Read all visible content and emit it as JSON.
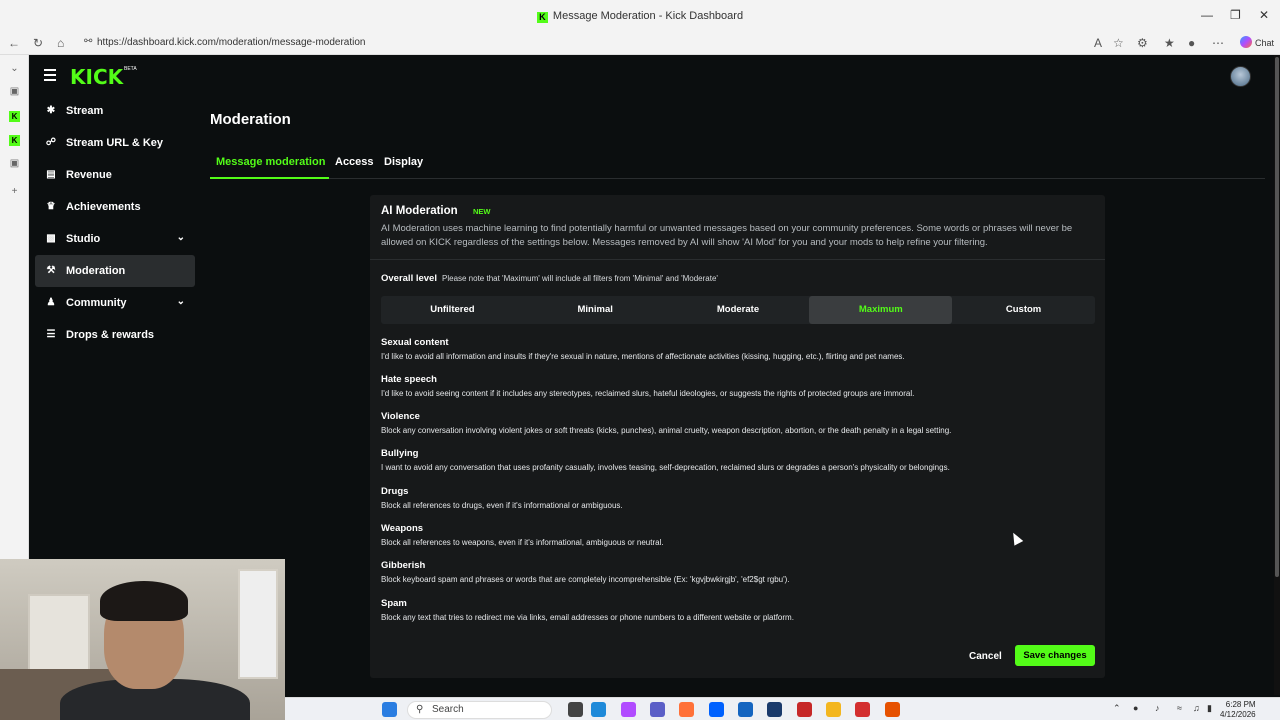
{
  "browser": {
    "window_title": "Message Moderation - Kick Dashboard",
    "url": "https://dashboard.kick.com/moderation/message-moderation",
    "chat_label": "Chat"
  },
  "app": {
    "logo": "KICK",
    "logo_badge": "BETA"
  },
  "sidebar": {
    "items": [
      {
        "label": "Stream",
        "icon": "broadcast-icon"
      },
      {
        "label": "Stream URL & Key",
        "icon": "link-icon"
      },
      {
        "label": "Revenue",
        "icon": "chart-icon"
      },
      {
        "label": "Achievements",
        "icon": "trophy-icon"
      },
      {
        "label": "Studio",
        "icon": "monitor-icon"
      },
      {
        "label": "Moderation",
        "icon": "wrench-icon"
      },
      {
        "label": "Community",
        "icon": "people-icon"
      },
      {
        "label": "Drops & rewards",
        "icon": "gift-icon"
      }
    ]
  },
  "page": {
    "title": "Moderation",
    "tabs": [
      {
        "label": "Message moderation"
      },
      {
        "label": "Access"
      },
      {
        "label": "Display"
      }
    ]
  },
  "ai_moderation": {
    "title": "AI Moderation",
    "badge": "NEW",
    "description": "AI Moderation uses machine learning to find potentially harmful or unwanted messages based on your community preferences. Some words or phrases will never be allowed on KICK regardless of the settings below. Messages removed by AI will show 'AI Mod' for you and your mods to help refine your filtering.",
    "overall_label": "Overall level",
    "overall_note": "Please note that 'Maximum' will include all filters from 'Minimal' and 'Moderate'",
    "levels": [
      "Unfiltered",
      "Minimal",
      "Moderate",
      "Maximum",
      "Custom"
    ],
    "selected_level": "Maximum",
    "categories": [
      {
        "title": "Sexual content",
        "desc": "I'd like to avoid all information and insults if they're sexual in nature, mentions of affectionate activities (kissing, hugging, etc.), flirting and pet names."
      },
      {
        "title": "Hate speech",
        "desc": "I'd like to avoid seeing content if it includes any stereotypes, reclaimed slurs, hateful ideologies, or suggests the rights of protected groups are immoral."
      },
      {
        "title": "Violence",
        "desc": "Block any conversation involving violent jokes or soft threats (kicks, punches), animal cruelty, weapon description, abortion, or the death penalty in a legal setting."
      },
      {
        "title": "Bullying",
        "desc": "I want to avoid any conversation that uses profanity casually, involves teasing, self-deprecation, reclaimed slurs or degrades a person's physicality or belongings."
      },
      {
        "title": "Drugs",
        "desc": "Block all references to drugs, even if it's informational or ambiguous."
      },
      {
        "title": "Weapons",
        "desc": "Block all references to weapons, even if it's informational, ambiguous or neutral."
      },
      {
        "title": "Gibberish",
        "desc": "Block keyboard spam and phrases or words that are completely incomprehensible (Ex: 'kgvjbwkirgjb', 'ef2$gt rgbu')."
      },
      {
        "title": "Spam",
        "desc": "Block any text that tries to redirect me via links, email addresses or phone numbers to a different website or platform."
      }
    ],
    "cancel_label": "Cancel",
    "save_label": "Save changes"
  },
  "taskbar": {
    "search_placeholder": "Search",
    "time": "6:28 PM",
    "date": "4/12/2026"
  },
  "colors": {
    "accent": "#53fc18",
    "background": "#0b0e0f",
    "card": "#17191a"
  }
}
